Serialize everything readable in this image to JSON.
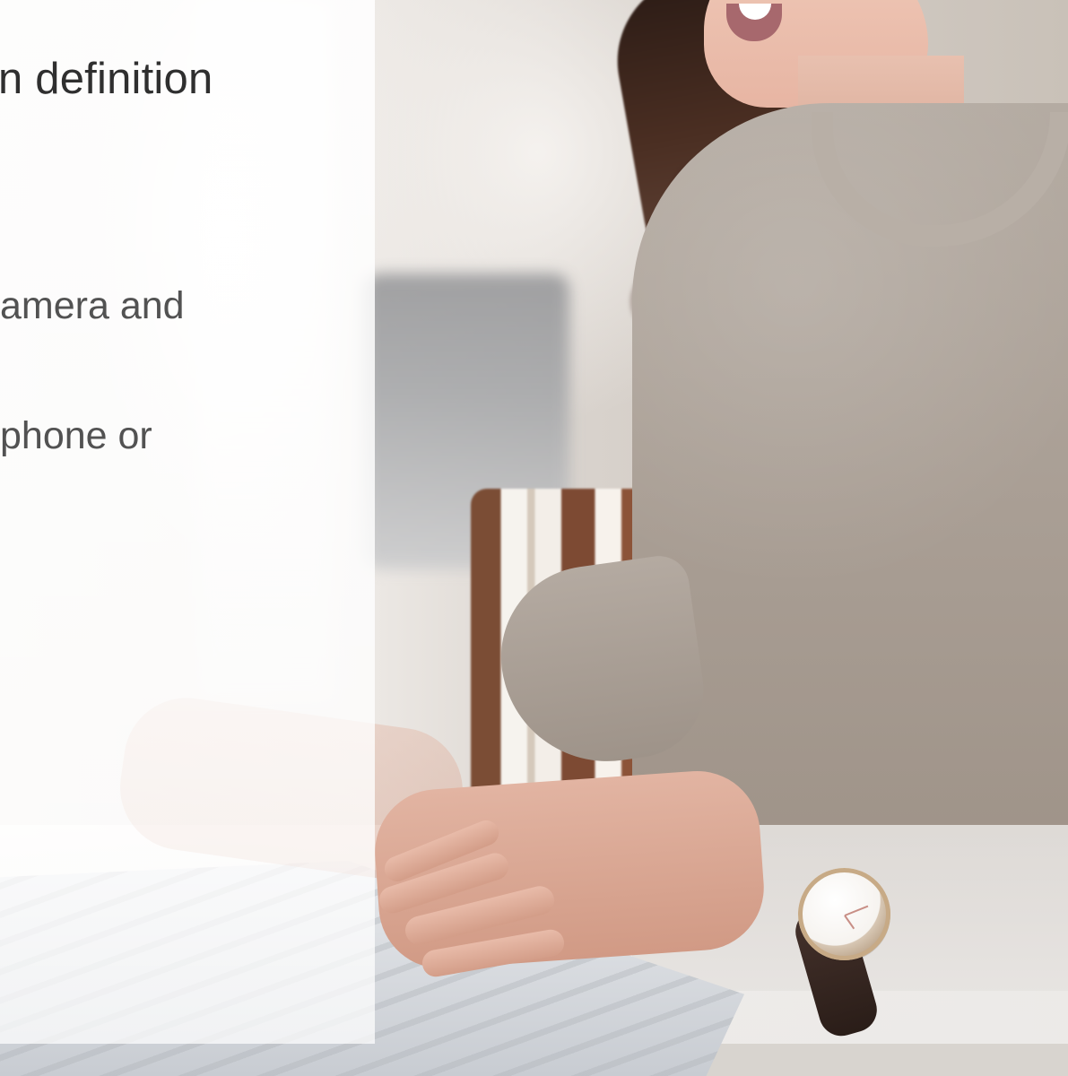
{
  "text_panel": {
    "title": "n definition",
    "line1": "amera and",
    "line2": " phone or"
  }
}
